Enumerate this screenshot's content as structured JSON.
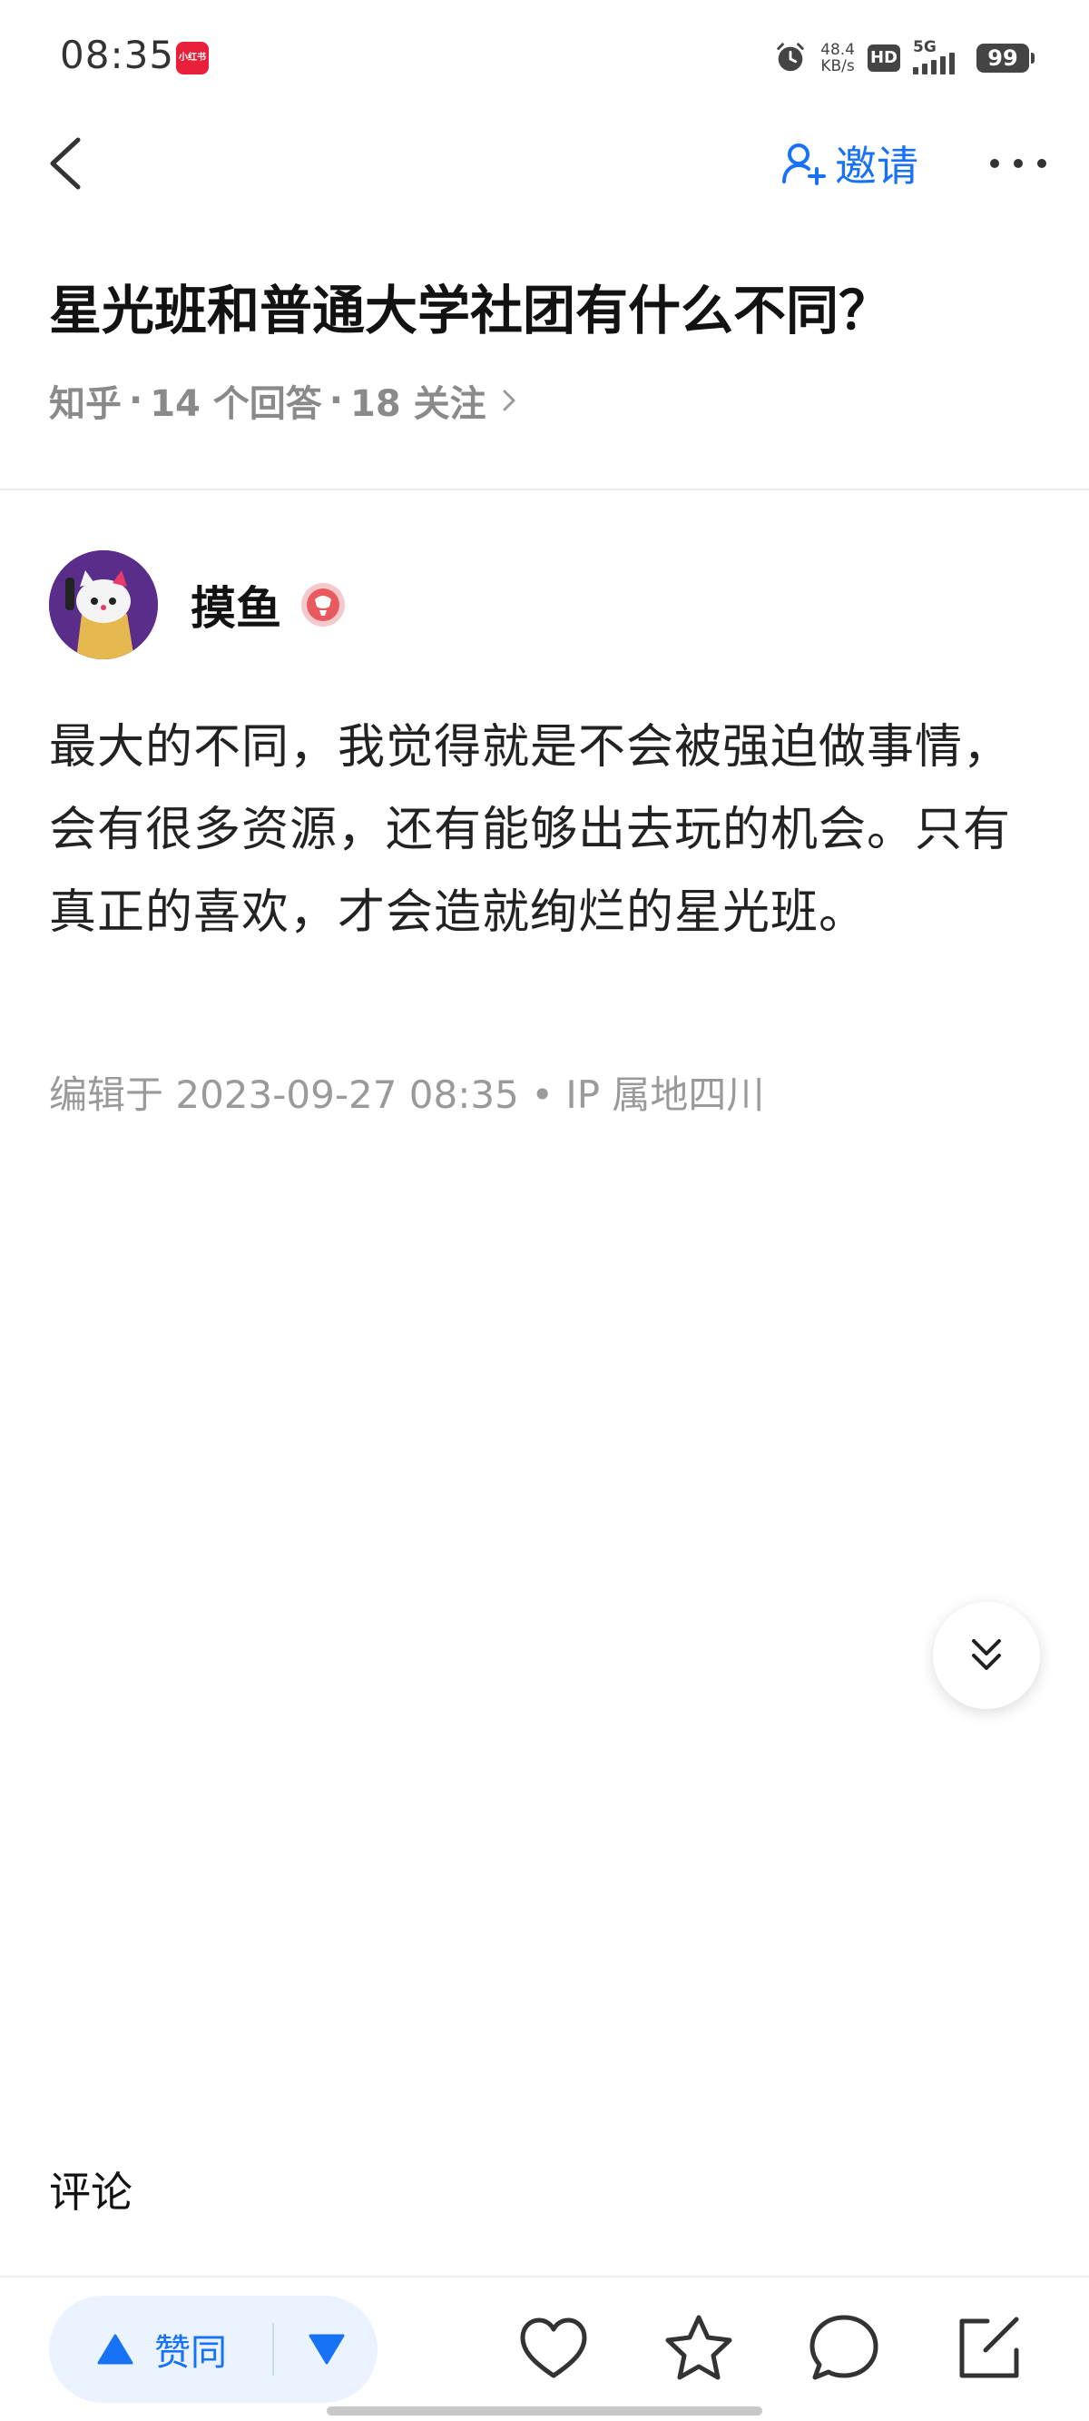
{
  "status_bar": {
    "time": "08:35",
    "app_badge": "小红书",
    "net_speed_value": "48.4",
    "net_speed_unit": "KB/s",
    "hd": "HD",
    "signal": "5G",
    "battery": "99"
  },
  "nav": {
    "invite_label": "邀请"
  },
  "question": {
    "title": "星光班和普通大学社团有什么不同？",
    "source": "知乎",
    "answers": "14 个回答",
    "followers": "18 关注",
    "separator": "·"
  },
  "answer": {
    "author_name": "摸鱼",
    "content": "最大的不同，我觉得就是不会被强迫做事情，会有很多资源，还有能够出去玩的机会。只有真正的喜欢，才会造就绚烂的星光班。",
    "edited": "编辑于 2023-09-27 08:35",
    "ip_location": "IP 属地四川",
    "meta_separator": "•"
  },
  "comments": {
    "label": "评论"
  },
  "bottom_bar": {
    "upvote_label": "赞同"
  },
  "colors": {
    "accent": "#1772f6",
    "vote_bg": "#ebf3ff",
    "muted_text": "#8a8a8a",
    "avatar_bg": "#5a2d8a"
  },
  "icons": {
    "alarm": "alarm-icon",
    "back": "chevron-left-icon",
    "invite": "add-user-icon",
    "more": "more-horizontal-icon",
    "badge": "medal-icon",
    "collapse": "double-chevron-down-icon",
    "like": "heart-icon",
    "favorite": "star-icon",
    "comment": "comment-bubble-icon",
    "edit": "edit-icon"
  }
}
